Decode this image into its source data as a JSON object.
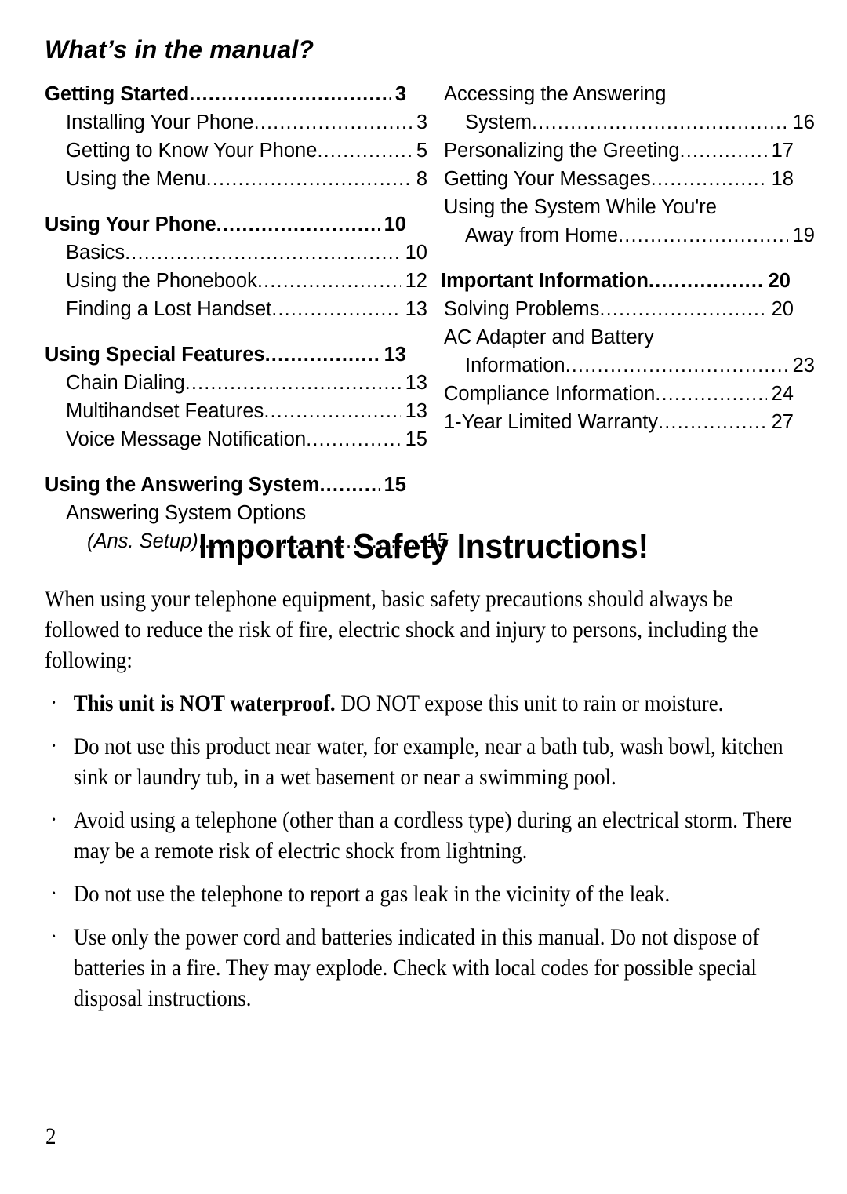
{
  "toc": {
    "title": "What’s in the manual?",
    "left_column": [
      {
        "level": 1,
        "label": "Getting Started",
        "page": "3"
      },
      {
        "level": 2,
        "label": "Installing Your Phone",
        "page": "3"
      },
      {
        "level": 2,
        "label": "Getting to Know Your Phone",
        "page": "5"
      },
      {
        "level": 2,
        "label": "Using the Menu",
        "page": "8"
      },
      {
        "level": 1,
        "label": "Using Your Phone",
        "page": "10"
      },
      {
        "level": 2,
        "label": "Basics",
        "page": "10"
      },
      {
        "level": 2,
        "label": "Using the Phonebook",
        "page": "12"
      },
      {
        "level": 2,
        "label": "Finding a Lost Handset",
        "page": "13"
      },
      {
        "level": 1,
        "label": "Using Special Features",
        "page": "13"
      },
      {
        "level": 2,
        "label": "Chain Dialing",
        "page": "13"
      },
      {
        "level": 2,
        "label": "Multihandset Features",
        "page": "13"
      },
      {
        "level": 2,
        "label": "Voice Message Notification",
        "page": "15"
      },
      {
        "level": 1,
        "label": "Using the Answering System",
        "page": "15"
      },
      {
        "level": 2,
        "label": "Answering System Options",
        "page": "",
        "no_page": true
      },
      {
        "level": 2,
        "label": "(Ans. Setup)",
        "page": "15",
        "continuation": true,
        "italic": true
      }
    ],
    "right_column": [
      {
        "level": 2,
        "label": "Accessing the Answering",
        "page": "",
        "no_page": true
      },
      {
        "level": 2,
        "label": "System",
        "page": "16",
        "continuation": true
      },
      {
        "level": 2,
        "label": "Personalizing the Greeting",
        "page": "17"
      },
      {
        "level": 2,
        "label": "Getting Your Messages",
        "page": "18"
      },
      {
        "level": 2,
        "label": "Using the System While You're",
        "page": "",
        "no_page": true
      },
      {
        "level": 2,
        "label": "Away from Home",
        "page": "19",
        "continuation": true
      },
      {
        "level": 1,
        "label": "Important Information",
        "page": "20"
      },
      {
        "level": 2,
        "label": "Solving Problems",
        "page": "20"
      },
      {
        "level": 2,
        "label": "AC Adapter and Battery",
        "page": "",
        "no_page": true
      },
      {
        "level": 2,
        "label": "Information",
        "page": "23",
        "continuation": true
      },
      {
        "level": 2,
        "label": "Compliance Information",
        "page": "24"
      },
      {
        "level": 2,
        "label": "1-Year Limited Warranty",
        "page": "27"
      }
    ]
  },
  "safety": {
    "heading": "Important Safety Instructions!",
    "intro": "When using your telephone equipment, basic safety precautions should always be followed to reduce the risk of fire, electric shock and injury to persons, including the following:",
    "bullets": [
      {
        "bold_lead": "This unit is NOT waterproof.",
        "text": " DO NOT expose this unit to rain or moisture."
      },
      {
        "bold_lead": "",
        "text": "Do not use this product near water, for example, near a bath tub, wash bowl, kitchen sink or laundry tub, in a wet basement or near a swimming pool."
      },
      {
        "bold_lead": "",
        "text": "Avoid using a telephone (other than a cordless type) during an electrical storm. There may be a remote risk of electric shock from lightning."
      },
      {
        "bold_lead": "",
        "text": "Do not use the telephone to report a gas leak in the vicinity of the leak."
      },
      {
        "bold_lead": "",
        "text": "Use only the power cord and batteries indicated in this manual. Do not dispose of batteries in a fire. They may explode. Check with local codes for possible special disposal instructions."
      }
    ]
  },
  "footer": {
    "page_number": "2"
  }
}
